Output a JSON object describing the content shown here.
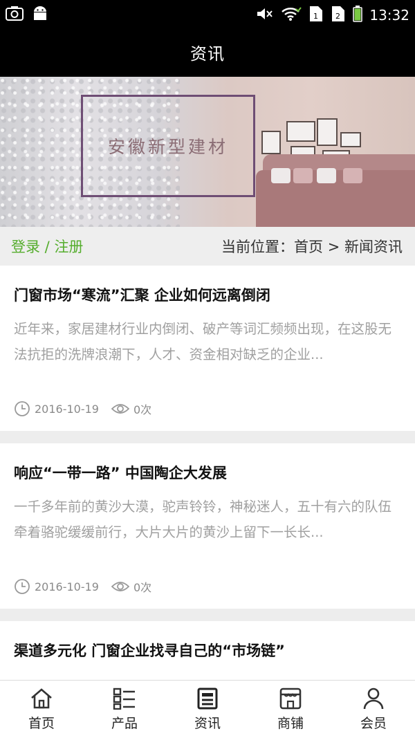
{
  "status_bar": {
    "time": "13:32",
    "left_icons": [
      "screenshot-icon",
      "android-icon"
    ],
    "right_icons": [
      "mute-icon",
      "wifi-icon",
      "sim1-icon",
      "sim2-icon",
      "battery-icon"
    ]
  },
  "header": {
    "title": "资讯"
  },
  "banner": {
    "text": "安徽新型建材"
  },
  "breadcrumb": {
    "login": "登录",
    "separator": " / ",
    "register": "注册",
    "location": "当前位置：首页 > 新闻资讯"
  },
  "news": [
    {
      "title": "门窗市场“寒流”汇聚 企业如何远离倒闭",
      "summary": "近年来，家居建材行业内倒闭、破产等词汇频频出现，在这股无法抗拒的洗牌浪潮下，人才、资金相对缺乏的企业...",
      "date": "2016-10-19",
      "views": "0次"
    },
    {
      "title": "响应“一带一路” 中国陶企大发展",
      "summary": "一千多年前的黄沙大漠，驼声铃铃，神秘迷人，五十有六的队伍牵着骆驼缓缓前行，大片大片的黄沙上留下一长长...",
      "date": "2016-10-19",
      "views": "0次"
    },
    {
      "title": "渠道多元化 门窗企业找寻自己的“市场链”"
    }
  ],
  "bottom_nav": [
    {
      "label": "首页",
      "icon": "home-icon"
    },
    {
      "label": "产品",
      "icon": "product-list-icon"
    },
    {
      "label": "资讯",
      "icon": "news-icon"
    },
    {
      "label": "商铺",
      "icon": "shop-icon"
    },
    {
      "label": "会员",
      "icon": "member-icon"
    }
  ],
  "colors": {
    "accent_green": "#55ad2d",
    "header_bg": "#000000",
    "summary_text": "#a0a0a0"
  }
}
